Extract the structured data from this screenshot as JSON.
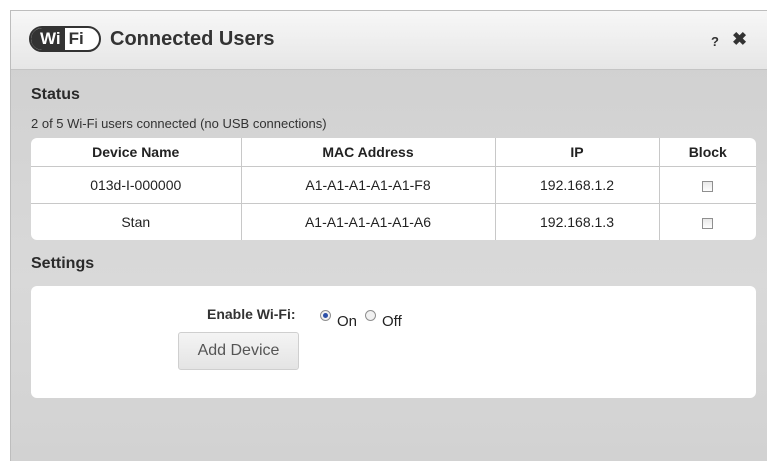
{
  "dialog": {
    "logo": {
      "wi": "Wi",
      "fi": "Fi"
    },
    "title": "Connected Users",
    "help_label": "?",
    "close_label": "✖"
  },
  "status": {
    "heading": "Status",
    "summary": "2 of 5 Wi-Fi users connected (no USB connections)",
    "columns": [
      "Device Name",
      "MAC Address",
      "IP",
      "Block"
    ],
    "rows": [
      {
        "device": "013d-I-000000",
        "mac": "A1-A1-A1-A1-A1-F8",
        "ip": "192.168.1.2",
        "blocked": false
      },
      {
        "device": "Stan",
        "mac": "A1-A1-A1-A1-A1-A6",
        "ip": "192.168.1.3",
        "blocked": false
      }
    ]
  },
  "settings": {
    "heading": "Settings",
    "wifi_label": "Enable Wi-Fi:",
    "on_label": "On",
    "off_label": "Off",
    "wifi_selected": "On",
    "add_device_label": "Add Device"
  }
}
